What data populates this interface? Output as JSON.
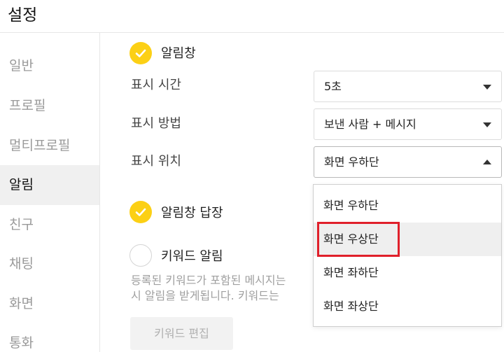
{
  "title": "설정",
  "sidebar": {
    "items": [
      {
        "label": "일반"
      },
      {
        "label": "프로필"
      },
      {
        "label": "멀티프로필"
      },
      {
        "label": "알림"
      },
      {
        "label": "친구"
      },
      {
        "label": "채팅"
      },
      {
        "label": "화면"
      },
      {
        "label": "통화"
      }
    ],
    "active": "알림"
  },
  "notification": {
    "popup_label": "알림창",
    "popup_checked": true,
    "display_time_label": "표시 시간",
    "display_time_value": "5초",
    "display_method_label": "표시 방법",
    "display_method_value": "보낸 사람 + 메시지",
    "display_position_label": "표시 위치",
    "display_position_value": "화면 우하단",
    "reply_label": "알림창 답장",
    "reply_checked": true,
    "keyword_label": "키워드 알림",
    "keyword_checked": false,
    "keyword_desc_line1": "등록된 키워드가 포함된 메시지는",
    "keyword_desc_line2": "시 알림을 받게됩니다. 키워드는",
    "keyword_edit_button": "키워드 편집"
  },
  "position_dropdown": {
    "options": [
      "화면 우하단",
      "화면 우상단",
      "화면 좌하단",
      "화면 좌상단"
    ],
    "hovered": "화면 우상단"
  },
  "colors": {
    "accent_yellow": "#fcd015",
    "highlight_red": "#e0202b"
  }
}
